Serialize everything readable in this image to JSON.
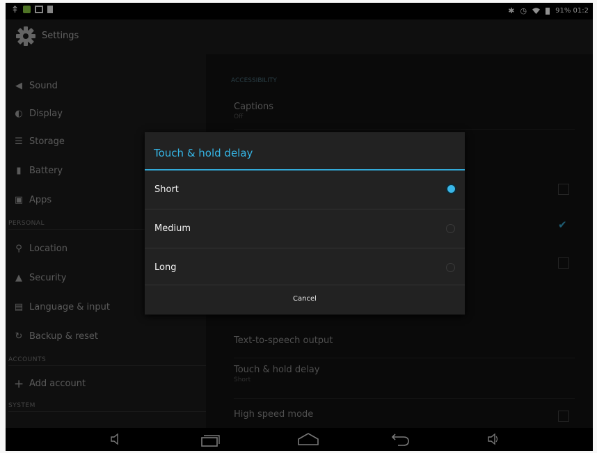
{
  "status_bar": {
    "left_icons": [
      "usb-icon",
      "notification-icon",
      "storage-icon",
      "sd-card-icon"
    ],
    "right_icons": [
      "bluetooth-icon",
      "alarm-icon",
      "wifi-icon",
      "battery-icon"
    ],
    "battery_text": "91% 01:2"
  },
  "action_bar": {
    "title": "Settings",
    "icon": "settings-gear-icon"
  },
  "sidebar": {
    "items": [
      {
        "icon": "volume-icon",
        "label": "Sound"
      },
      {
        "icon": "brightness-icon",
        "label": "Display"
      },
      {
        "icon": "storage-icon",
        "label": "Storage"
      },
      {
        "icon": "battery-icon",
        "label": "Battery"
      },
      {
        "icon": "apps-icon",
        "label": "Apps"
      },
      {
        "icon": "location-icon",
        "label": "Location"
      },
      {
        "icon": "lock-icon",
        "label": "Security"
      },
      {
        "icon": "keyboard-icon",
        "label": "Language & input"
      },
      {
        "icon": "backup-icon",
        "label": "Backup & reset"
      },
      {
        "icon": "add-icon",
        "label": "Add account"
      }
    ],
    "sections": {
      "personal": "PERSONAL",
      "accounts": "ACCOUNTS",
      "system": "SYSTEM"
    }
  },
  "main": {
    "section_label": "ACCESSIBILITY",
    "rows": [
      {
        "title": "Captions",
        "subtitle": "Off"
      },
      {
        "title": "Text-to-speech output",
        "subtitle": ""
      },
      {
        "title": "Touch & hold delay",
        "subtitle": "Short"
      },
      {
        "title": "High speed mode",
        "subtitle": ""
      }
    ]
  },
  "dialog": {
    "title": "Touch & hold delay",
    "options": [
      {
        "label": "Short",
        "selected": true
      },
      {
        "label": "Medium",
        "selected": false
      },
      {
        "label": "Long",
        "selected": false
      }
    ],
    "cancel_label": "Cancel"
  },
  "nav_bar": {
    "icons": [
      "volume-down-icon",
      "recent-apps-icon",
      "home-icon",
      "back-icon",
      "volume-up-icon"
    ]
  },
  "colors": {
    "accent": "#33b5e5",
    "background": "#101010"
  }
}
